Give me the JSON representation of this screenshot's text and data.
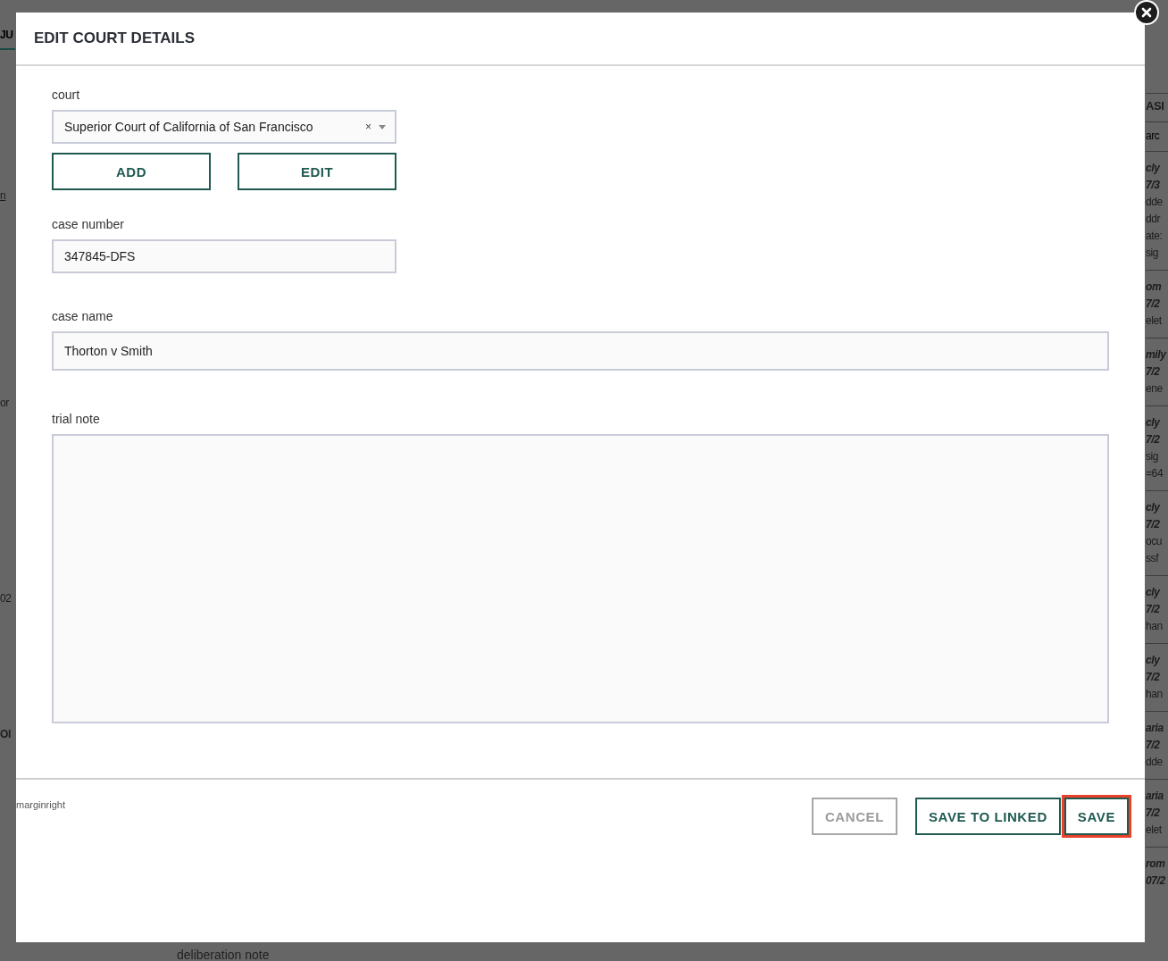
{
  "background": {
    "left_fragments": [
      {
        "text": "JU",
        "kind": "tab"
      },
      {
        "text": "n",
        "kind": "link"
      },
      {
        "text": "or",
        "kind": "text"
      },
      {
        "text": "02",
        "kind": "text"
      },
      {
        "text": "OI",
        "kind": "heading"
      }
    ],
    "right_heading": "ASI",
    "right_search_placeholder": "arc",
    "right_entries": [
      [
        "cly",
        "7/3",
        "dde",
        "ddr",
        "ate:",
        "sig"
      ],
      [
        "om",
        "7/2",
        "elet"
      ],
      [
        "mily",
        "7/2",
        "ene"
      ],
      [
        "cly",
        "7/2",
        "sig",
        "=64"
      ],
      [
        "cly",
        "7/2",
        "ocu",
        "ssf"
      ],
      [
        "cly",
        "7/2",
        "han"
      ],
      [
        "cly",
        "7/2",
        "han"
      ],
      [
        "aria",
        "7/2",
        "dde"
      ],
      [
        "aria",
        "7/2",
        "elet"
      ],
      [
        "rom",
        "07/2"
      ]
    ],
    "bottom_label": "deliberation note"
  },
  "dialog": {
    "title": "EDIT COURT DETAILS",
    "fields": [
      {
        "kind": "select",
        "label": "court",
        "value": "Superior Court of California of San Francisco",
        "clear_glyph": "×",
        "buttons": [
          "ADD",
          "EDIT"
        ]
      },
      {
        "kind": "text",
        "label": "case number",
        "value": "347845-DFS"
      },
      {
        "kind": "wide",
        "label": "case name",
        "value": "Thorton v Smith"
      },
      {
        "kind": "textarea",
        "label": "trial note"
      }
    ],
    "footer_note": "marginright",
    "buttons": [
      {
        "label": "CANCEL",
        "kind": "secondary",
        "focused": false
      },
      {
        "label": "SAVE TO LINKED",
        "kind": "primary",
        "focused": false
      },
      {
        "label": "SAVE",
        "kind": "primary",
        "focused": true
      }
    ]
  }
}
